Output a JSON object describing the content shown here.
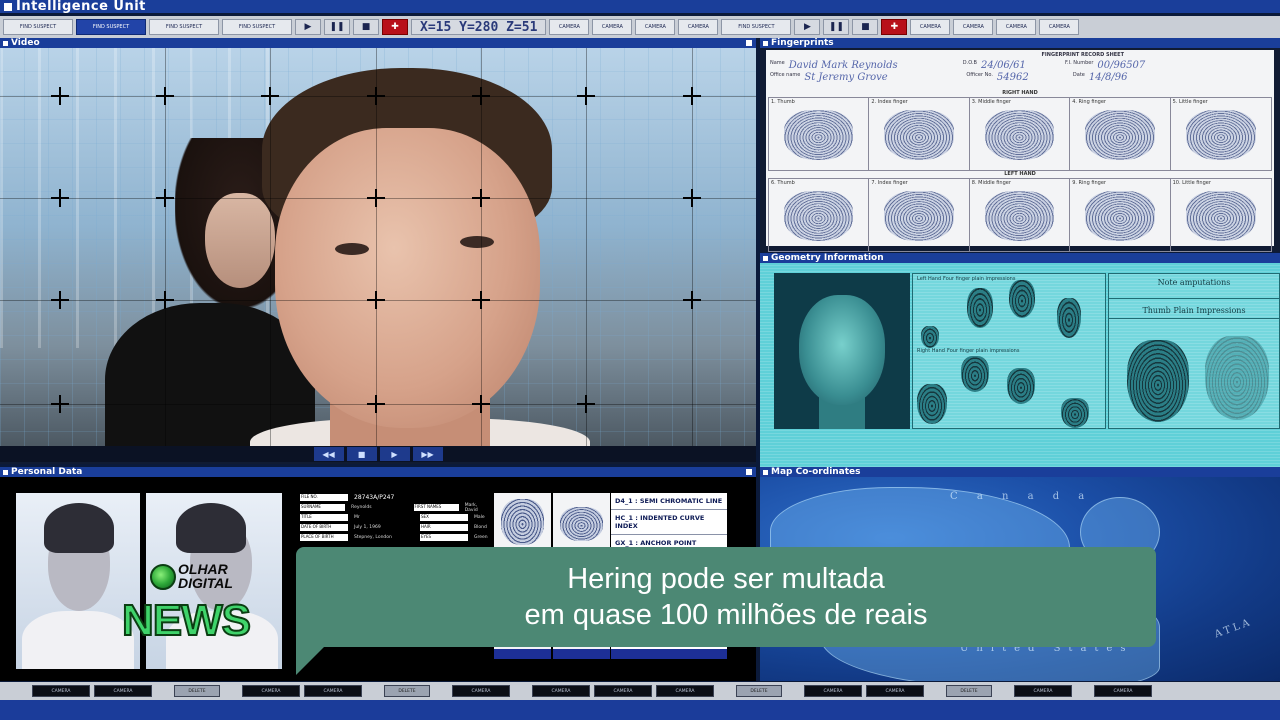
{
  "app": {
    "title": "Intelligence Unit"
  },
  "toolbar": {
    "buttons": [
      "FIND SUSPECT",
      "FIND SUSPECT",
      "FIND SUSPECT",
      "FIND SUSPECT"
    ],
    "coords": "X=15  Y=280  Z=51",
    "camera_buttons": [
      "CAMERA",
      "CAMERA",
      "CAMERA",
      "CAMERA"
    ],
    "right_buttons": [
      "FIND SUSPECT",
      "CAMERA",
      "CAMERA",
      "CAMERA",
      "CAMERA"
    ]
  },
  "panels": {
    "video": "Video",
    "fingerprints": "Fingerprints",
    "geometry": "Geometry Information",
    "personal": "Personal Data",
    "map": "Map Co-ordinates"
  },
  "fingerprints": {
    "sheet_title": "FINGERPRINT RECORD SHEET",
    "name_label": "Name",
    "name_value": "David Mark Reynolds",
    "office_label": "Office name",
    "office_value": "St Jeremy Grove",
    "dob_label": "D.O.B",
    "dob_value": "24/06/61",
    "officer_label": "Officer No.",
    "officer_value": "54962",
    "ref_label": "F.I. Number",
    "ref_value": "00/96507",
    "date_label": "Date",
    "date_value": "14/8/96",
    "right_hand": "RIGHT HAND",
    "left_hand": "LEFT HAND",
    "right_fingers": [
      "1. Thumb",
      "2. Index finger",
      "3. Middle finger",
      "4. Ring finger",
      "5. Little finger"
    ],
    "left_fingers": [
      "6. Thumb",
      "7. Index finger",
      "8. Middle finger",
      "9. Ring finger",
      "10. Little finger"
    ]
  },
  "geometry": {
    "left_hand": "Left Hand",
    "right_hand": "Right Hand",
    "prints_label": "Four finger plain impressions",
    "note": "Note amputations",
    "thumb": "Thumb Plain Impressions"
  },
  "personal": {
    "file_no_label": "FILE NO.",
    "file_no": "28743A/P247",
    "rows": [
      {
        "k": "SURNAME",
        "v": "Reynolds"
      },
      {
        "k": "TITLE",
        "v": "Mr"
      },
      {
        "k": "DATE OF BIRTH",
        "v": "July 1, 1969"
      },
      {
        "k": "PLACE OF BIRTH",
        "v": "Stepney, London"
      }
    ],
    "rows2": [
      {
        "k": "FIRST NAMES",
        "v": "Mark, David"
      },
      {
        "k": "SEX",
        "v": "Male"
      },
      {
        "k": "HAIR",
        "v": "Blond"
      },
      {
        "k": "EYES",
        "v": "Green"
      }
    ],
    "codes": [
      "D4_1 : SEMI CHROMATIC LINE",
      "HC_1 : INDENTED CURVE INDEX",
      "GX_1 : ANCHOR POINT DEPTH"
    ]
  },
  "map": {
    "canada": "C a n a d a",
    "us": "United States",
    "atlantic": "ATLA"
  },
  "bottombar": {
    "buttons": [
      "CAMERA",
      "CAMERA",
      "DELETE",
      "CAMERA",
      "CAMERA",
      "DELETE",
      "CAMERA",
      "CAMERA",
      "CAMERA",
      "CAMERA",
      "DELETE",
      "CAMERA",
      "CAMERA",
      "DELETE",
      "CAMERA",
      "CAMERA"
    ]
  },
  "caption": {
    "line1": "Hering pode ser multada",
    "line2": "em quase 100 milhões de reais"
  },
  "logo": {
    "top": "OLHAR",
    "mid": "DIGITAL",
    "bottom": "NEWS"
  },
  "colors": {
    "accent": "#1a3e9a",
    "caption_bg": "#4c8874",
    "logo_green": "#3fd36a"
  }
}
